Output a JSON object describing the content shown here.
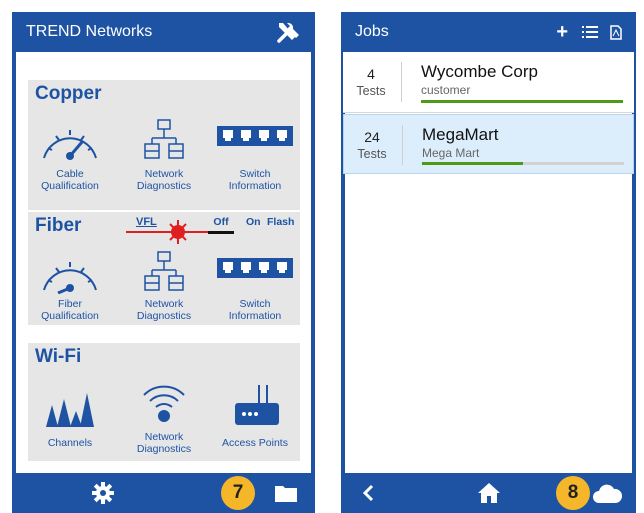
{
  "left": {
    "title": "TREND Networks",
    "copper": {
      "title": "Copper",
      "tiles": [
        {
          "icon": "gauge-icon",
          "label": "Cable\nQualification"
        },
        {
          "icon": "network-diagnostics-icon",
          "label": "Network\nDiagnostics"
        },
        {
          "icon": "switch-icon",
          "label": "Switch\nInformation"
        }
      ]
    },
    "fiber": {
      "title": "Fiber",
      "vfl": {
        "label": "VFL",
        "options": [
          "Off",
          "On",
          "Flash"
        ],
        "selected": "Off",
        "accent": "#e02020"
      },
      "tiles": [
        {
          "icon": "gauge-icon",
          "label": "Fiber\nQualification"
        },
        {
          "icon": "network-diagnostics-icon",
          "label": "Network\nDiagnostics"
        },
        {
          "icon": "switch-icon",
          "label": "Switch\nInformation"
        }
      ]
    },
    "wifi": {
      "title": "Wi-Fi",
      "tiles": [
        {
          "icon": "channels-icon",
          "label": "Channels"
        },
        {
          "icon": "wifi-icon",
          "label": "Network\nDiagnostics"
        },
        {
          "icon": "access-point-icon",
          "label": "Access Points"
        }
      ]
    },
    "bottom": {
      "settings_icon": "gear-icon",
      "badge": "7",
      "folder_icon": "folder-icon"
    }
  },
  "right": {
    "title": "Jobs",
    "header_icons": [
      "plus-icon",
      "list-icon",
      "pdf-icon"
    ],
    "jobs": [
      {
        "count": "4",
        "tests_label": "Tests",
        "name": "Wycombe Corp",
        "subtitle": "customer",
        "progress": 1.0,
        "selected": false
      },
      {
        "count": "24",
        "tests_label": "Tests",
        "name": "MegaMart",
        "subtitle": "Mega Mart",
        "progress": 0.5,
        "selected": true
      }
    ],
    "bottom": {
      "back_icon": "chevron-left-icon",
      "home_icon": "home-icon",
      "badge": "8",
      "cloud_icon": "cloud-icon"
    }
  },
  "colors": {
    "brand": "#1e53a4",
    "panel": "#e6e6e6",
    "progress": "#4d9a16",
    "badge": "#f5b62a",
    "selected_row": "#dceefc"
  }
}
